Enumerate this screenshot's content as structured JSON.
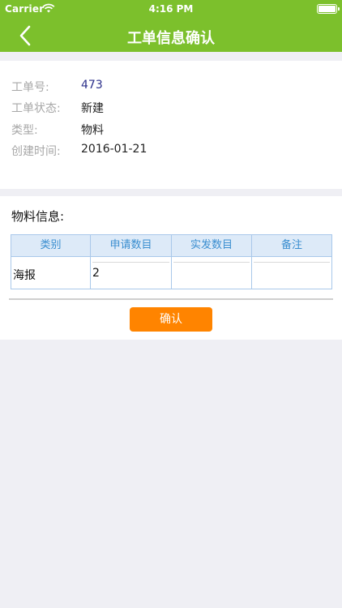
{
  "status_bar": {
    "carrier": "Carrier",
    "time": "4:16 PM"
  },
  "nav": {
    "title": "工单信息确认",
    "back_icon": "chevron-left-icon"
  },
  "work_order": {
    "fields": [
      {
        "label": "工单号:",
        "value": "473"
      },
      {
        "label": "工单状态:",
        "value": "新建"
      },
      {
        "label": "类型:",
        "value": "物料"
      },
      {
        "label": "创建时间:",
        "value": "2016-01-21"
      }
    ]
  },
  "materials": {
    "title": "物料信息:",
    "headers": [
      "类别",
      "申请数目",
      "实发数目",
      "备注"
    ],
    "rows": [
      {
        "category": "海报",
        "requested": "2",
        "issued": "",
        "remark": ""
      }
    ]
  },
  "actions": {
    "confirm_label": "确认"
  },
  "colors": {
    "nav_green": "#7cc02c",
    "confirm_orange": "#ff8400",
    "table_header_bg": "#ddeaf8",
    "table_header_text": "#3a8ed0",
    "order_number": "#2b2f8a"
  }
}
